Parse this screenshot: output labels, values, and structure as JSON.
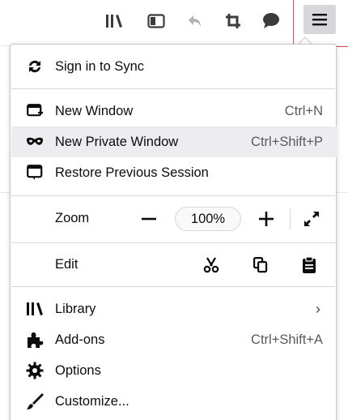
{
  "toolbar": {
    "icons": [
      "library-icon",
      "sidebar-icon",
      "undo-icon",
      "crop-icon",
      "speech-bubble-icon"
    ],
    "menu_icon": "hamburger-icon",
    "highlight_color": "#d9534f"
  },
  "menu": {
    "sync": {
      "label": "Sign in to Sync",
      "icon": "sync-icon"
    },
    "new_window": {
      "label": "New Window",
      "shortcut": "Ctrl+N",
      "icon": "new-window-icon"
    },
    "private_window": {
      "label": "New Private Window",
      "shortcut": "Ctrl+Shift+P",
      "icon": "mask-icon"
    },
    "restore_session": {
      "label": "Restore Previous Session",
      "icon": "restore-icon"
    },
    "zoom": {
      "label": "Zoom",
      "value": "100%",
      "out": "−",
      "in": "+"
    },
    "edit": {
      "label": "Edit"
    },
    "library": {
      "label": "Library",
      "chevron": "›",
      "icon": "library-icon"
    },
    "addons": {
      "label": "Add-ons",
      "shortcut": "Ctrl+Shift+A",
      "icon": "puzzle-icon"
    },
    "options": {
      "label": "Options",
      "icon": "gear-icon"
    },
    "customize": {
      "label": "Customize...",
      "icon": "brush-icon"
    }
  }
}
